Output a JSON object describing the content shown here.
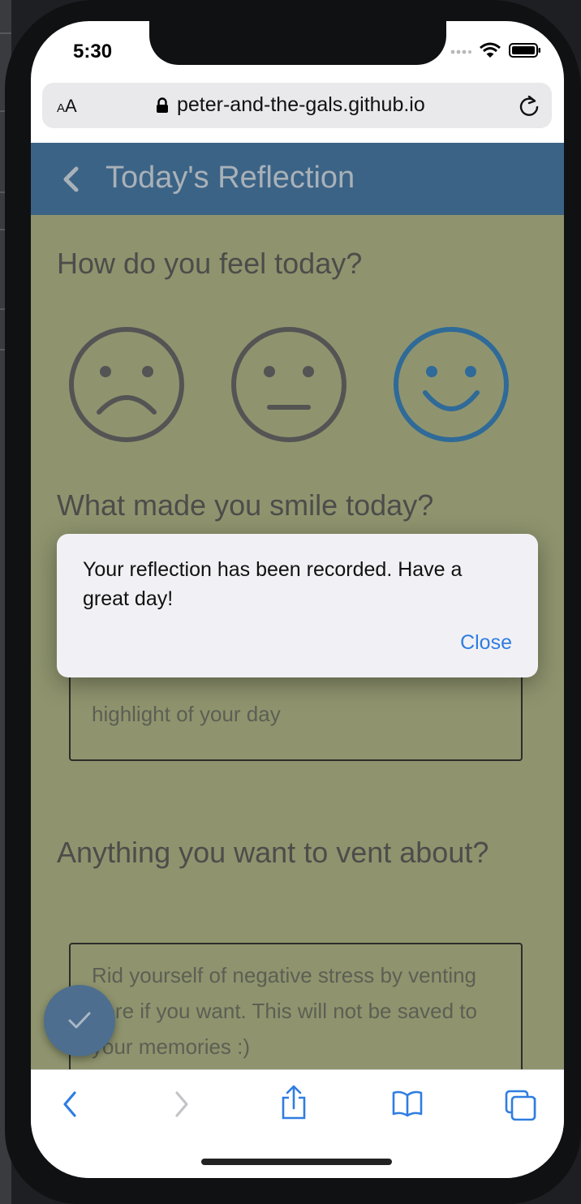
{
  "status_bar": {
    "time": "5:30"
  },
  "browser": {
    "text_size_label_small": "A",
    "text_size_label_large": "A",
    "url": "peter-and-the-gals.github.io"
  },
  "app": {
    "title": "Today's Reflection"
  },
  "questions": {
    "feel": "How do you feel today?",
    "smile": "What made you smile today?",
    "vent": "Anything you want to vent about?"
  },
  "moods": [
    {
      "name": "sad",
      "selected": false
    },
    {
      "name": "neutral",
      "selected": false
    },
    {
      "name": "happy",
      "selected": true
    }
  ],
  "inputs": {
    "smile_placeholder": "highlight of your day",
    "vent_placeholder": "Rid yourself of negative stress by venting here if you want. This will not be saved to your memories :)"
  },
  "dialog": {
    "message": "Your reflection has been recorded. Have a great day!",
    "close_label": "Close"
  },
  "colors": {
    "app_bar": "#3b6386",
    "background": "#8f946e",
    "selected_mood": "#2f6a98",
    "unselected_mood": "#545454",
    "link": "#2f7de1"
  },
  "icons": [
    "back-icon",
    "checkmark-icon",
    "share-icon",
    "bookmarks-icon",
    "tabs-icon",
    "lock-icon",
    "reload-icon"
  ]
}
